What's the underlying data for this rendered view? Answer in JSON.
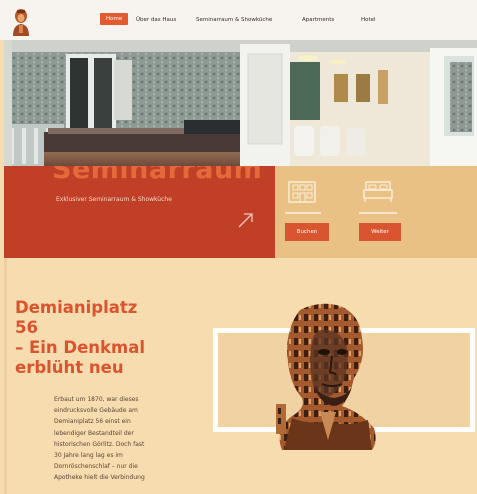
{
  "nav": {
    "items": [
      {
        "label": "Home",
        "active": true
      },
      {
        "label": "Über das Haus",
        "active": false
      },
      {
        "label": "Seminarraum & Showküche",
        "active": false
      },
      {
        "label": "Apartments",
        "active": false
      },
      {
        "label": "Hotel",
        "active": false
      }
    ]
  },
  "hero": {
    "big_word": "Seminarraum",
    "subtitle": "Exklusiver Seminarraum & Showküche"
  },
  "features": {
    "buttons": [
      "Buchen",
      "Weiter"
    ]
  },
  "intro": {
    "title_lines": [
      "Demianiplatz",
      "56",
      "– Ein Denkmal",
      "erblüht neu"
    ],
    "body_lines": [
      "Erbaut um 1870, war dieses",
      "eindrucksvolle Gebäude am",
      "Demianiplatz 56 einst ein",
      "lebendiger Bestandteil der",
      "historischen Görlitz. Doch fast",
      "30 Jahre lang lag es im",
      "Dornröschenschlaf – nur die",
      "Apotheke hielt die Verbindung"
    ]
  },
  "colors": {
    "accent": "#e35a31",
    "red_panel": "#c13f27",
    "sand_panel": "#e9c184",
    "background": "#f6dcaf"
  },
  "icons": [
    "logo-icon",
    "arrow-up-right-icon",
    "building-icon",
    "bed-icon"
  ]
}
